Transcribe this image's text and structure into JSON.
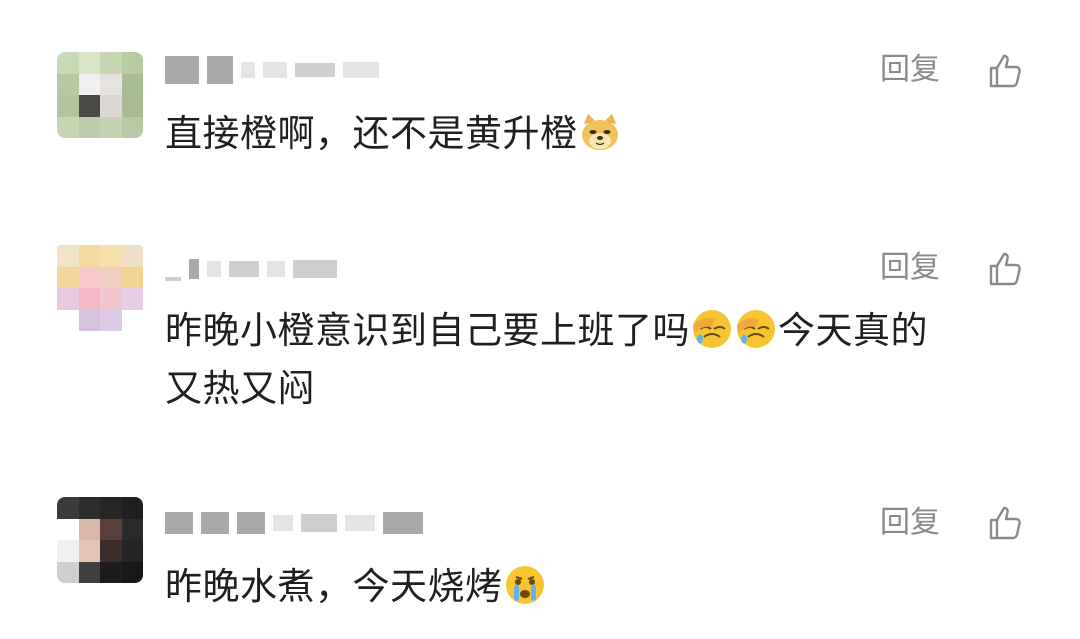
{
  "comments": [
    {
      "text_parts": [
        "直接橙啊，还不是黄升橙"
      ],
      "emojis": [
        "doge-emoji"
      ],
      "reply_label": "回复"
    },
    {
      "text_parts": [
        "昨晚小橙意识到自己要上班了吗",
        "今天真的",
        "又热又闷"
      ],
      "emojis": [
        "facepalm-emoji",
        "facepalm-emoji"
      ],
      "reply_label": "回复"
    },
    {
      "text_parts": [
        "昨晚水煮，今天烧烤"
      ],
      "emojis": [
        "crying-emoji"
      ],
      "reply_label": "回复"
    }
  ],
  "icons": {
    "like": "thumbs-up-icon",
    "like_color": "#8a8a8a"
  },
  "colors": {
    "text": "#1f1f1f",
    "meta": "#8a8a8a",
    "emoji_yellow": "#f7c531"
  }
}
